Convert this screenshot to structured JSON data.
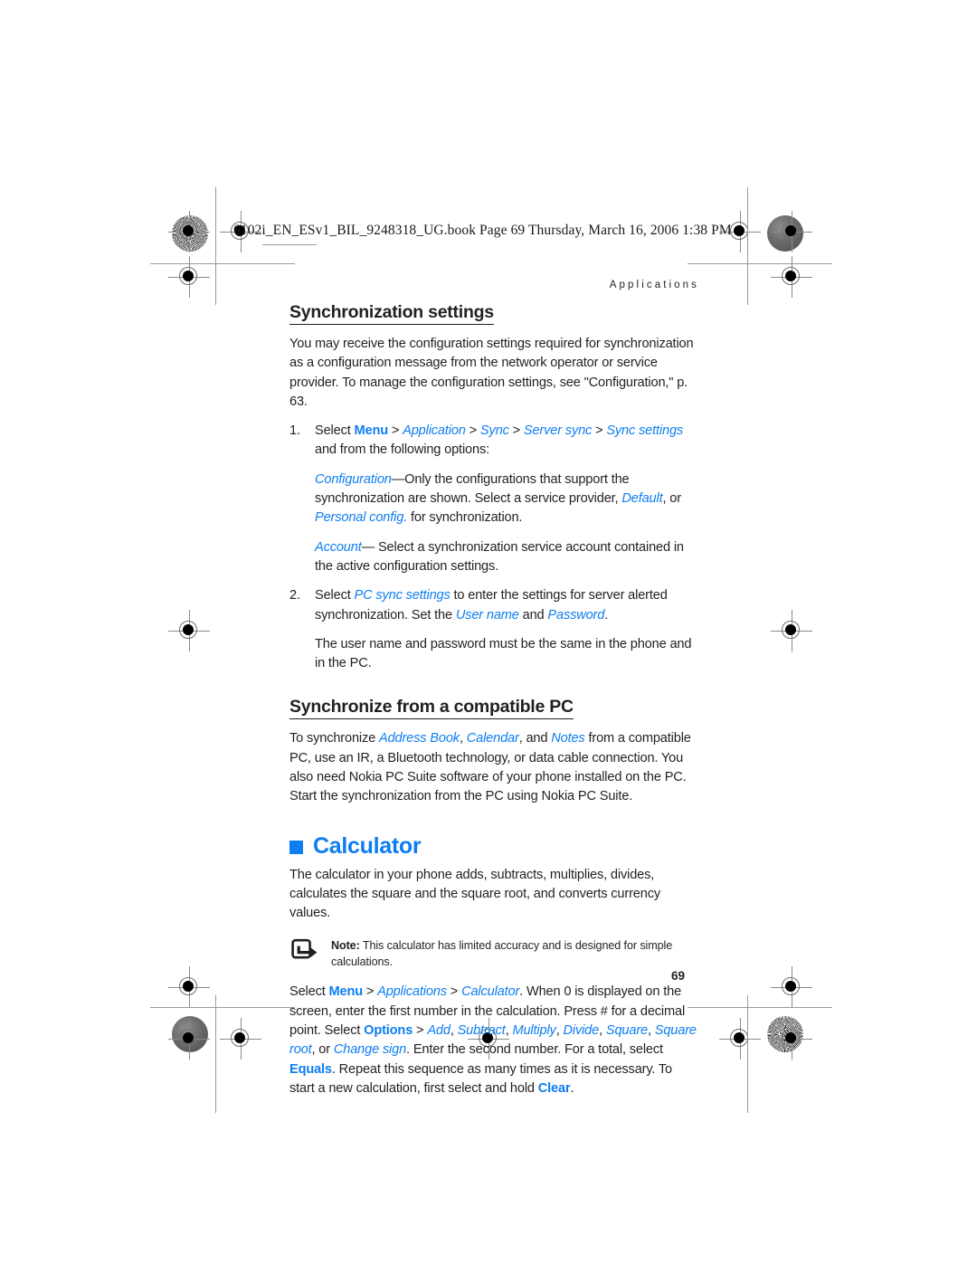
{
  "page": {
    "book_line": "6102i_EN_ESv1_BIL_9248318_UG.book   Page 69   Thursday, March 16, 2006   1:38 PM",
    "running_head": "Applications",
    "folio": "69",
    "accent_color": "#0d7ef2",
    "text_color": "#231f20"
  },
  "sections": {
    "sync_settings": {
      "heading": "Synchronization settings",
      "intro": "You may receive the configuration settings required for synchronization as a configuration message from the network operator or service provider. To manage the configuration settings, see \"Configuration,\" p. 63.",
      "step1": {
        "number": "1.",
        "lead": "Select ",
        "menu": "Menu",
        "sep1": " > ",
        "application": "Application",
        "sep2": " > ",
        "sync": "Sync",
        "sep3": " > ",
        "server_sync": "Server sync",
        "sep4": " > ",
        "sync_settings": "Sync settings",
        "tail": " and from the following options:"
      },
      "configuration_option": {
        "term": "Configuration",
        "text_a": "—Only the configurations that support the synchronization are shown. Select a service provider, ",
        "default": "Default",
        "text_b": ", or ",
        "personal_config": "Personal config.",
        "text_c": " for synchronization."
      },
      "account_option": {
        "term": "Account",
        "text": "— Select a synchronization service account contained in the active configuration settings."
      },
      "step2": {
        "number": "2.",
        "lead": "Select ",
        "pc_sync_settings": "PC sync settings",
        "text_a": " to enter the settings for server alerted synchronization. Set the ",
        "user_name": "User name",
        "text_b": " and ",
        "password": "Password",
        "text_c": "."
      },
      "note_after_step2": "The user name and password must be the same in the phone and in the PC."
    },
    "sync_from_pc": {
      "heading": "Synchronize from a compatible PC",
      "text_a": "To synchronize ",
      "address_book": "Address Book",
      "text_b": ", ",
      "calendar": "Calendar",
      "text_c": ", and ",
      "notes": "Notes",
      "text_d": " from a compatible PC, use an IR, a Bluetooth technology, or data cable connection. You also need Nokia PC Suite software of your phone installed on the PC. Start the synchronization from the PC using Nokia PC Suite."
    },
    "calculator": {
      "heading": "Calculator",
      "bullet_icon": "blue-square-bullet",
      "intro": "The calculator in your phone adds, subtracts, multiplies, divides, calculates the square and the square root, and converts currency values.",
      "note": {
        "icon": "note-arrow-icon",
        "label": "Note:",
        "text": " This calculator has limited accuracy and is designed for simple calculations."
      },
      "instructions": {
        "lead": "Select ",
        "menu": "Menu",
        "sep1": " > ",
        "applications": "Applications",
        "sep2": " > ",
        "calculator": "Calculator",
        "text_a": ". When 0 is displayed on the screen, enter the first number in the calculation. Press # for a decimal point. Select ",
        "options": "Options",
        "sep3": " > ",
        "add": "Add",
        "c1": ", ",
        "subtract": "Subtract",
        "c2": ", ",
        "multiply": "Multiply",
        "c3": ", ",
        "divide": "Divide",
        "c4": ", ",
        "square": "Square",
        "c5": ", ",
        "square_root": "Square root",
        "text_b": ", or ",
        "change_sign": "Change sign",
        "text_c": ". Enter the second number. For a total, select ",
        "equals": "Equals",
        "text_d": ". Repeat this sequence as many times as it is necessary. To start a new calculation, first select and hold ",
        "clear": "Clear",
        "text_e": "."
      }
    }
  }
}
